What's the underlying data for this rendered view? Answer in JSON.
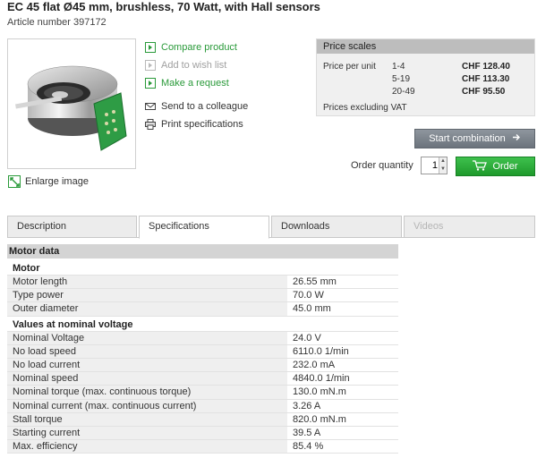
{
  "product": {
    "title": "EC 45 flat Ø45 mm, brushless, 70 Watt, with Hall sensors",
    "article": "Article number 397172"
  },
  "enlarge_label": "Enlarge image",
  "actions": {
    "compare": "Compare product",
    "wishlist": "Add to wish list",
    "request": "Make a request",
    "send": "Send to a colleague",
    "print": "Print specifications"
  },
  "prices": {
    "header": "Price scales",
    "per_unit_label": "Price per unit",
    "rows": [
      {
        "range": "1-4",
        "price": "CHF 128.40"
      },
      {
        "range": "5-19",
        "price": "CHF 113.30"
      },
      {
        "range": "20-49",
        "price": "CHF 95.50"
      }
    ],
    "note": "Prices excluding VAT"
  },
  "cart": {
    "start_combination": "Start combination",
    "qty_label": "Order quantity",
    "qty_value": "1",
    "order": "Order"
  },
  "tabs": [
    "Description",
    "Specifications",
    "Downloads",
    "Videos"
  ],
  "spec": {
    "heading": "Motor data",
    "group1": "Motor",
    "motor": [
      {
        "k": "Motor length",
        "v": "26.55 mm"
      },
      {
        "k": "Type power",
        "v": "70.0 W"
      },
      {
        "k": "Outer diameter",
        "v": "45.0 mm"
      }
    ],
    "group2": "Values at nominal voltage",
    "nominal": [
      {
        "k": "Nominal Voltage",
        "v": "24.0 V"
      },
      {
        "k": "No load speed",
        "v": "6110.0 1/min"
      },
      {
        "k": "No load current",
        "v": "232.0 mA"
      },
      {
        "k": "Nominal speed",
        "v": "4840.0 1/min"
      },
      {
        "k": "Nominal torque (max. continuous torque)",
        "v": "130.0 mN.m"
      },
      {
        "k": "Nominal current (max. continuous current)",
        "v": "3.26 A"
      },
      {
        "k": "Stall torque",
        "v": "820.0 mN.m"
      },
      {
        "k": "Starting current",
        "v": "39.5 A"
      },
      {
        "k": "Max. efficiency",
        "v": "85.4 %"
      }
    ]
  },
  "colors": {
    "green": "#2a9a3a",
    "order_button": "#27a835",
    "start_button": "#7b828a",
    "price_header": "#bdbdbd"
  },
  "icons": {
    "compare": "arrow-right-icon",
    "wishlist": "arrow-right-icon",
    "request": "arrow-right-icon",
    "send": "envelope-icon",
    "print": "printer-icon",
    "enlarge": "enlarge-icon",
    "start": "arrow-right-icon",
    "order": "cart-icon"
  }
}
